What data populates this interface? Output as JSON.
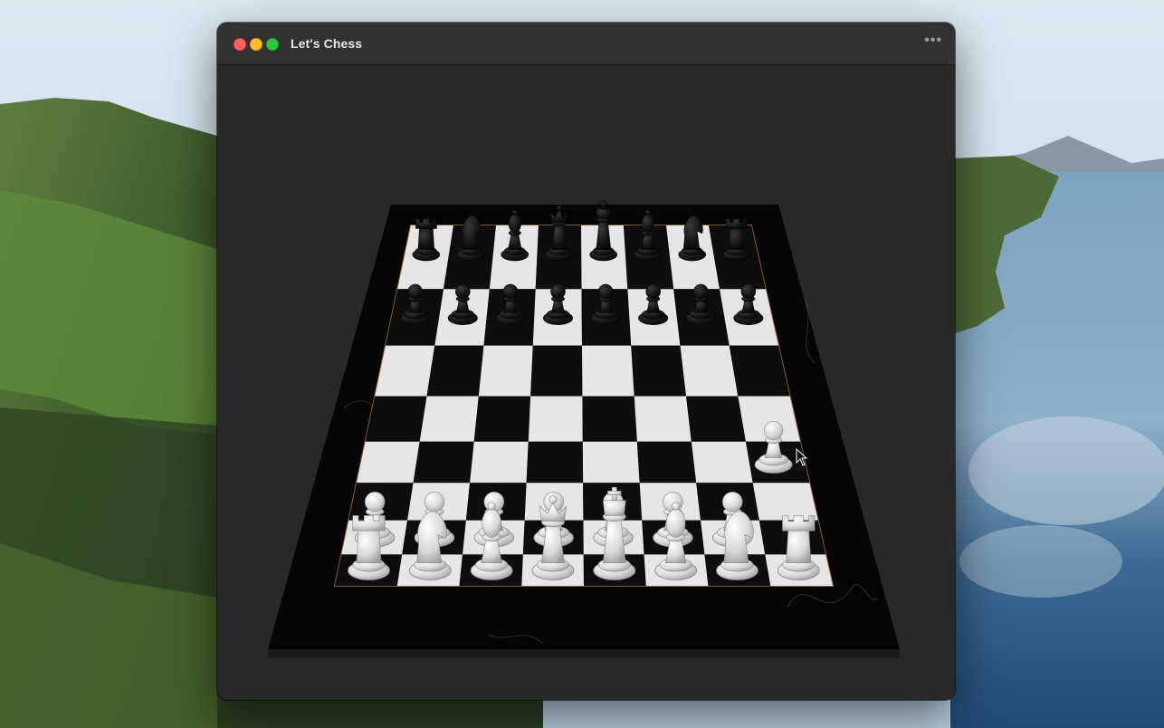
{
  "window": {
    "title": "Let's Chess",
    "more_label": "•••"
  },
  "board": {
    "files": 8,
    "ranks": 8,
    "light_square": "#e6e6e6",
    "dark_square": "#0d0d0d",
    "frame_color": "#050505",
    "pieces": {
      "black_back": [
        "rook",
        "knight",
        "bishop",
        "queen",
        "king",
        "bishop",
        "knight",
        "rook"
      ],
      "black_pawns": 8,
      "white_pawns": 8,
      "white_back": [
        "rook",
        "knight",
        "bishop",
        "queen",
        "king",
        "bishop",
        "knight",
        "rook"
      ],
      "lifted_piece": "white-pawn"
    }
  },
  "colors": {
    "window_bg": "#282828",
    "titlebar_bg": "#323232",
    "close": "#ff5f57",
    "minimize": "#febc2e",
    "zoom": "#28c840"
  }
}
